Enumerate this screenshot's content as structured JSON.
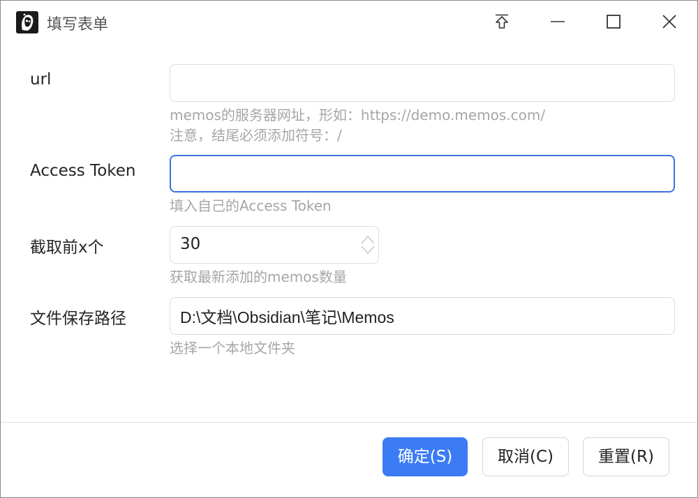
{
  "window": {
    "title": "填写表单",
    "icons": {
      "app": "app-logo-icon",
      "pin": "pin-top-icon",
      "minimize": "minimize-icon",
      "maximize": "maximize-icon",
      "close": "close-icon"
    }
  },
  "form": {
    "url": {
      "label": "url",
      "value": "",
      "hint_line1": "memos的服务器网址，形如：https://demo.memos.com/",
      "hint_line2": "注意，结尾必须添加符号：/"
    },
    "token": {
      "label": "Access Token",
      "value": "",
      "hint": "填入自己的Access Token"
    },
    "count": {
      "label": "截取前x个",
      "value": "30",
      "hint": "获取最新添加的memos数量"
    },
    "path": {
      "label": "文件保存路径",
      "value": "D:\\文档\\Obsidian\\笔记\\Memos",
      "hint": "选择一个本地文件夹"
    }
  },
  "buttons": {
    "confirm": "确定(S)",
    "cancel": "取消(C)",
    "reset": "重置(R)"
  },
  "colors": {
    "primary": "#3b7cf5",
    "focus_border": "#3d6fe0",
    "hint": "#a6a6a6"
  }
}
